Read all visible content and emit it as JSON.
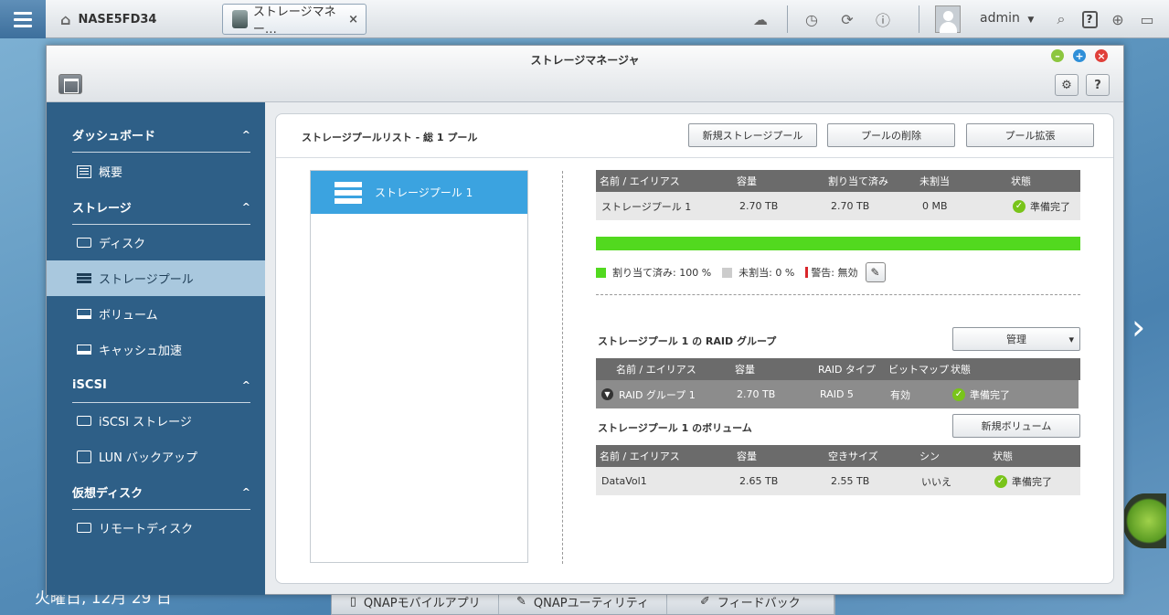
{
  "topbar": {
    "host_name": "NASE5FD34",
    "tab_label": "ストレージマネー…",
    "tab_close": "×",
    "user_name": "admin",
    "user_dropdown": "▼",
    "help_label": "?"
  },
  "window": {
    "title": "ストレージマネージャ",
    "help_label": "?",
    "minimize": "–",
    "maximize": "+",
    "close": "×"
  },
  "sidebar": {
    "sections": [
      {
        "label": "ダッシュボード",
        "items": [
          {
            "label": "概要",
            "icon": "list-icon"
          }
        ]
      },
      {
        "label": "ストレージ",
        "items": [
          {
            "label": "ディスク",
            "icon": "disk-icon"
          },
          {
            "label": "ストレージプール",
            "icon": "storage-pool-icon"
          },
          {
            "label": "ボリューム",
            "icon": "volume-icon"
          },
          {
            "label": "キャッシュ加速",
            "icon": "cache-icon"
          }
        ]
      },
      {
        "label": "iSCSI",
        "items": [
          {
            "label": "iSCSI ストレージ",
            "icon": "iscsi-icon"
          },
          {
            "label": "LUN バックアップ",
            "icon": "lun-backup-icon"
          }
        ]
      },
      {
        "label": "仮想ディスク",
        "items": [
          {
            "label": "リモートディスク",
            "icon": "remote-disk-icon"
          }
        ]
      }
    ],
    "collapse_glyph": "^",
    "active_item": "ストレージプール"
  },
  "main": {
    "list_title": "ストレージプールリスト - 総 1 プール",
    "buttons": {
      "new_pool": "新規ストレージプール",
      "delete_pool": "プールの削除",
      "expand_pool": "プール拡張"
    },
    "pool_list": [
      {
        "label": "ストレージプール 1"
      }
    ],
    "pool_table": {
      "headers": [
        "名前 / エイリアス",
        "容量",
        "割り当て済み",
        "未割当",
        "状態"
      ],
      "rows": [
        {
          "name": "ストレージプール 1",
          "capacity": "2.70 TB",
          "allocated": "2.70 TB",
          "unallocated": "0 MB",
          "status": "準備完了"
        }
      ]
    },
    "usage": {
      "allocated_percent": 100,
      "bar_color": "#52d91f",
      "allocated_label": "割り当て済み: 100 %",
      "unallocated_label": "未割当: 0 %",
      "warning_label": "警告: 無効",
      "allocated_color": "#52d91f",
      "unallocated_color": "#cccccc",
      "warning_color": "#d9262b"
    },
    "raid": {
      "title": "ストレージプール 1 の RAID グループ",
      "manage_button": "管理",
      "manage_caret": "▾",
      "headers": [
        "名前 / エイリアス",
        "容量",
        "RAID タイプ",
        "ビットマップ",
        "状態"
      ],
      "rows": [
        {
          "name": "RAID グループ 1",
          "capacity": "2.70 TB",
          "type": "RAID 5",
          "bitmap": "有効",
          "status": "準備完了"
        }
      ]
    },
    "volumes": {
      "title": "ストレージプール 1 のボリューム",
      "new_button": "新規ボリューム",
      "headers": [
        "名前 / エイリアス",
        "容量",
        "空きサイズ",
        "シン",
        "状態"
      ],
      "rows": [
        {
          "name": "DataVol1",
          "capacity": "2.65 TB",
          "free": "2.55 TB",
          "thin": "いいえ",
          "status": "準備完了"
        }
      ]
    }
  },
  "desktop": {
    "date_text": "火曜日, 12月 29 日",
    "taskbar": [
      "QNAPモバイルアプリ",
      "QNAPユーティリティ",
      "フィードバック"
    ],
    "next_arrow": "›"
  }
}
